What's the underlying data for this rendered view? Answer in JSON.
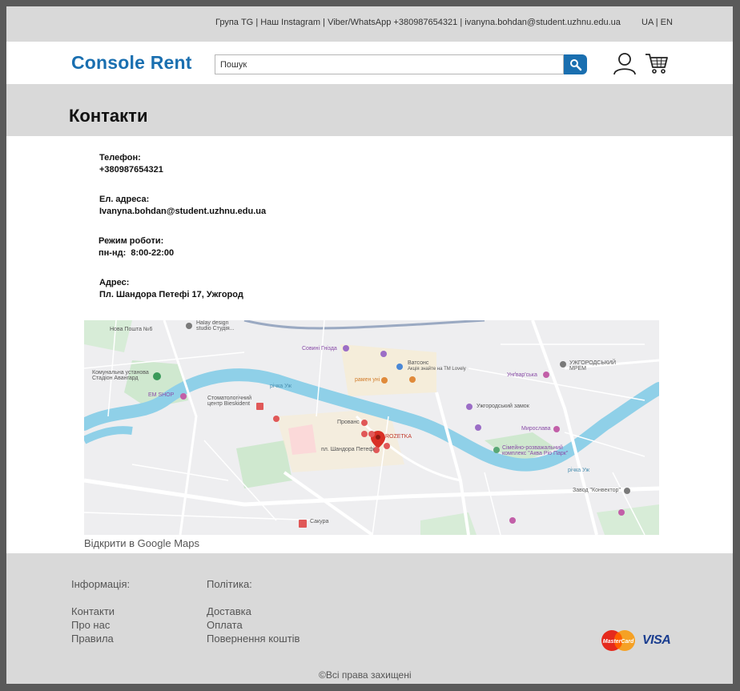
{
  "topbar": {
    "links": [
      "Група TG",
      "Наш Instagram",
      "Viber/WhatsApp +380987654321",
      "ivanyna.bohdan@student.uzhnu.edu.ua"
    ],
    "lang": [
      "UA",
      "EN"
    ]
  },
  "header": {
    "logo": "Console Rent",
    "search_placeholder": "Пошук"
  },
  "page": {
    "title": "Контакти"
  },
  "contacts": {
    "phone_label": "Телефон:",
    "phone_value": "+380987654321",
    "email_label": "Ел. адреса:",
    "email_value": "Ivanyna.bohdan@student.uzhnu.edu.ua",
    "hours_label": "Режим роботи:",
    "hours_value": "пн-нд:  8:00-22:00",
    "address_label": "Адрес:",
    "address_value": "Пл. Шандора Петефі 17, Ужгород"
  },
  "map": {
    "link": "Відкрити в Google Maps",
    "labels": {
      "nova_poshta": "Нова Пошта №6",
      "halay": "Halay design studio Студія...",
      "sovyn": "Совині Гнізда",
      "vatsons": "Ватсонс",
      "vatsons_sub": "Акція знайте на ТМ Lovely",
      "ramen": "рамен уні",
      "uzh_mrem": "УЖГОРОДСЬКИЙ МРЕМ",
      "ungvarska": "Унґвар'ська",
      "stadium": "Комунальна установа Стадіон Авангард",
      "em_shop": "EM SHOP",
      "stomatology": "Стоматологічний центр Bieskident",
      "provans": "Прованс",
      "rozetka": "ROZETKA",
      "petofi": "пл. Шандора Петефі",
      "castle": "Ужгородський замок",
      "myroslava": "Мирослава",
      "aqua": "Сімейно-розважальний комплекс \"Аква Ріо Парк\"",
      "konvektor": "Завод \"Конвектор\"",
      "sakura": "Сакура",
      "river1": "річка Уж",
      "river2": "річка Уж"
    }
  },
  "footer": {
    "info_head": "Інформація:",
    "info_links": [
      "Контакти",
      "Про нас",
      "Правила"
    ],
    "policy_head": "Політика:",
    "policy_links": [
      "Доставка",
      "Оплата",
      "Повернення коштів"
    ],
    "copyright": "©Всі права захищені",
    "mastercard": "MasterCard",
    "visa": "VISA"
  },
  "colors": {
    "brand": "#1a6fb0",
    "band": "#d9d9d9"
  }
}
